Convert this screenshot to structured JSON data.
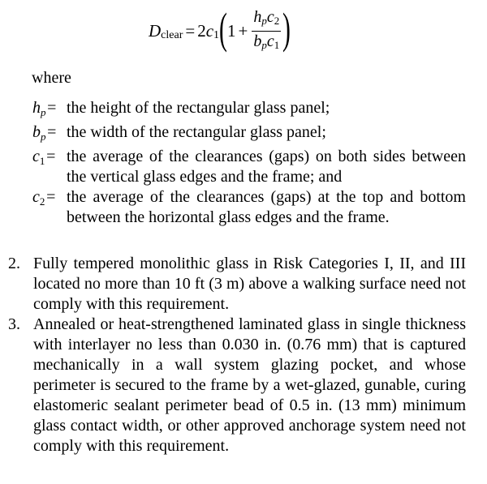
{
  "equation": {
    "lhs_symbol": "D",
    "lhs_subscript": "clear",
    "equals": "=",
    "coef": "2",
    "c1_symbol": "c",
    "c1_sub": "1",
    "one": "1",
    "plus": "+",
    "num_h": "h",
    "num_h_sub": "p",
    "num_c": "c",
    "num_c_sub": "2",
    "den_b": "b",
    "den_b_sub": "p",
    "den_c": "c",
    "den_c_sub": "1"
  },
  "where_label": "where",
  "definitions": [
    {
      "symbol": "h",
      "sub": "p",
      "sub_italic": true,
      "eq": "=",
      "text": "the height of the rectangular glass panel;"
    },
    {
      "symbol": "b",
      "sub": "p",
      "sub_italic": true,
      "eq": "=",
      "text": "the width of the rectangular glass panel;"
    },
    {
      "symbol": "c",
      "sub": "1",
      "sub_italic": false,
      "eq": "=",
      "text": "the average of the clearances (gaps) on both sides between the vertical glass edges and the frame; and"
    },
    {
      "symbol": "c",
      "sub": "2",
      "sub_italic": false,
      "eq": "=",
      "text": "the average of the clearances (gaps) at the top and bottom between the horizontal glass edges and the frame."
    }
  ],
  "exceptions": [
    {
      "number": "2.",
      "text": "Fully tempered monolithic glass in Risk Categories I, II, and III located no more than 10 ft (3 m) above a walking surface need not comply with this requirement."
    },
    {
      "number": "3.",
      "text": "Annealed or heat-strengthened laminated glass in single thickness with interlayer no less than 0.030 in. (0.76 mm) that is captured mechanically in a wall system glazing pocket, and whose perimeter is secured to the frame by a wet-glazed, gunable, curing elastomeric sealant perimeter bead of 0.5 in. (13 mm) minimum glass contact width, or other approved anchorage system need not comply with this requirement."
    }
  ]
}
